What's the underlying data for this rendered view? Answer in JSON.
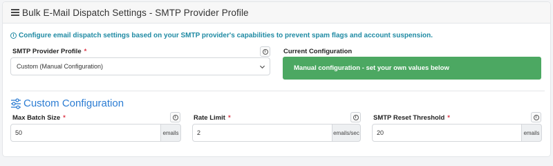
{
  "header": {
    "title": "Bulk E-Mail Dispatch Settings - SMTP Provider Profile",
    "icon": "list-icon"
  },
  "info": {
    "icon": "info-icon",
    "text": "Configure email dispatch settings based on your SMTP provider's capabilities to prevent spam flags and account suspension."
  },
  "provider": {
    "label": "SMTP Provider Profile",
    "required_mark": "*",
    "selected": "Custom (Manual Configuration)"
  },
  "current": {
    "label": "Current Configuration",
    "text": "Manual configuration - set your own values below",
    "color": "#4ca862"
  },
  "custom": {
    "title": "Custom Configuration",
    "color": "#2b7cd3"
  },
  "fields": {
    "batch": {
      "label": "Max Batch Size",
      "required_mark": "*",
      "value": "50",
      "unit": "emails"
    },
    "rate": {
      "label": "Rate Limit",
      "required_mark": "*",
      "value": "2",
      "unit": "emails/sec"
    },
    "reset": {
      "label": "SMTP Reset Threshold",
      "required_mark": "*",
      "value": "20",
      "unit": "emails"
    }
  },
  "help_glyph": "i"
}
